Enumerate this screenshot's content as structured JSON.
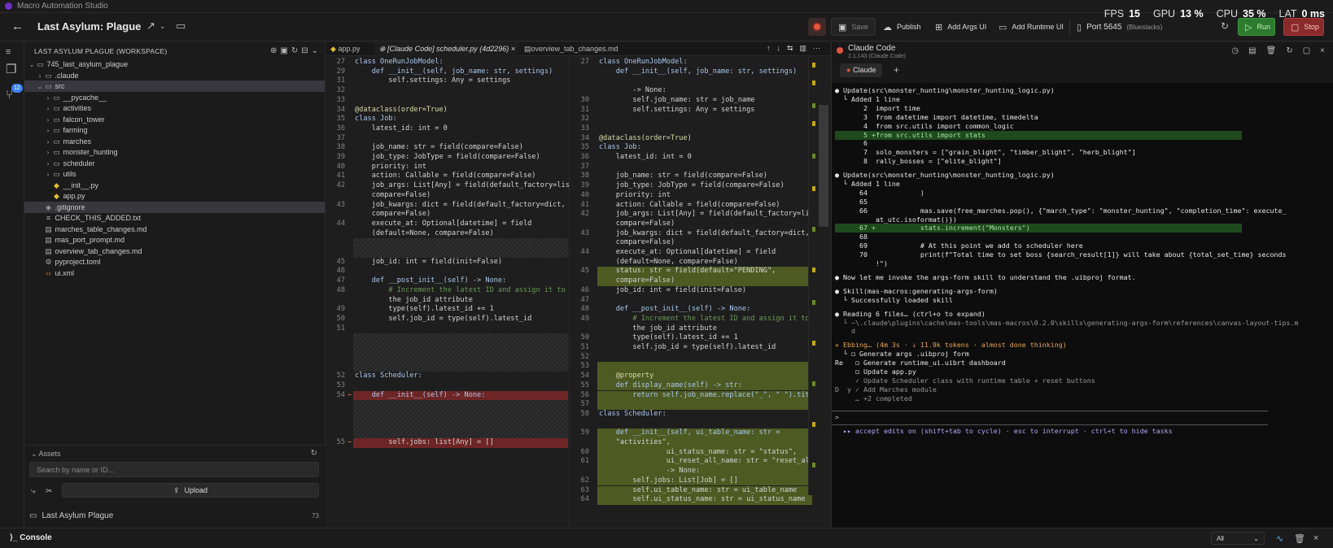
{
  "app": {
    "window_title": "Macro Automation Studio"
  },
  "toolbar": {
    "project_title": "Last Asylum: Plague",
    "save": "Save",
    "publish": "Publish",
    "add_args_ui": "Add Args UI",
    "add_runtime_ui": "Add Runtime UI",
    "port": "Port 5645",
    "port_note": "(Bluestacks)",
    "run": "Run",
    "stop": "Stop"
  },
  "stats": [
    {
      "label": "FPS",
      "value": "15"
    },
    {
      "label": "GPU",
      "value": "13 %"
    },
    {
      "label": "CPU",
      "value": "35 %"
    },
    {
      "label": "LAT",
      "value": "0 ms"
    }
  ],
  "sidebar": {
    "badge": "12"
  },
  "explorer": {
    "header": "LAST ASYLUM PLAGUE (WORKSPACE)",
    "items": [
      {
        "label": "745_last_asylum_plague",
        "indent": 0,
        "chev": "v",
        "icon": "folder-icon"
      },
      {
        "label": ".claude",
        "indent": 1,
        "chev": ">",
        "icon": "folder-icon"
      },
      {
        "label": "src",
        "indent": 1,
        "chev": "v",
        "icon": "folder-icon",
        "selected": true
      },
      {
        "label": "__pycache__",
        "indent": 2,
        "chev": ">",
        "icon": "folder-icon"
      },
      {
        "label": "activities",
        "indent": 2,
        "chev": ">",
        "icon": "folder-icon"
      },
      {
        "label": "falcon_tower",
        "indent": 2,
        "chev": ">",
        "icon": "folder-icon"
      },
      {
        "label": "farming",
        "indent": 2,
        "chev": ">",
        "icon": "folder-icon"
      },
      {
        "label": "marches",
        "indent": 2,
        "chev": ">",
        "icon": "folder-icon"
      },
      {
        "label": "monster_hunting",
        "indent": 2,
        "chev": ">",
        "icon": "folder-icon"
      },
      {
        "label": "scheduler",
        "indent": 2,
        "chev": ">",
        "icon": "folder-icon"
      },
      {
        "label": "utils",
        "indent": 2,
        "chev": ">",
        "icon": "folder-icon"
      },
      {
        "label": "__init__.py",
        "indent": 2,
        "chev": "",
        "icon": "python-file-icon"
      },
      {
        "label": "app.py",
        "indent": 2,
        "chev": "",
        "icon": "python-file-icon"
      },
      {
        "label": ".gitignore",
        "indent": 1,
        "chev": "",
        "icon": "gitignore-icon",
        "selected": true
      },
      {
        "label": "CHECK_THIS_ADDED.txt",
        "indent": 1,
        "chev": "",
        "icon": "text-file-icon"
      },
      {
        "label": "marches_table_changes.md",
        "indent": 1,
        "chev": "",
        "icon": "markdown-file-icon"
      },
      {
        "label": "mas_port_prompt.md",
        "indent": 1,
        "chev": "",
        "icon": "markdown-file-icon"
      },
      {
        "label": "overview_tab_changes.md",
        "indent": 1,
        "chev": "",
        "icon": "markdown-file-icon"
      },
      {
        "label": "pyproject.toml",
        "indent": 1,
        "chev": "",
        "icon": "toml-file-icon"
      },
      {
        "label": "ui.xml",
        "indent": 1,
        "chev": "",
        "icon": "xml-file-icon"
      }
    ]
  },
  "assets": {
    "header": "Assets",
    "search_placeholder": "Search by name or ID...",
    "upload": "Upload",
    "project": "Last Asylum Plague",
    "project_count": "73"
  },
  "editor": {
    "tabs": [
      {
        "label": "app.py"
      },
      {
        "label": "⊕ [Claude Code] scheduler.py (4d2296)",
        "active": true
      },
      {
        "label": "overview_tab_changes.md"
      }
    ],
    "left": [
      {
        "t": "text",
        "n": "27",
        "c": "class OneRunJobModel:"
      },
      {
        "t": "text",
        "n": "29",
        "c": "    def __init__(self, job_name: str, settings)"
      },
      {
        "t": "text",
        "n": "31",
        "c": "        self.settings: Any = settings"
      },
      {
        "t": "text",
        "n": "32",
        "c": ""
      },
      {
        "t": "text",
        "n": "33",
        "c": ""
      },
      {
        "t": "text",
        "n": "34",
        "c": "@dataclass(order=True)"
      },
      {
        "t": "text",
        "n": "35",
        "c": "class Job:"
      },
      {
        "t": "text",
        "n": "36",
        "c": "    latest_id: int = 0"
      },
      {
        "t": "text",
        "n": "37",
        "c": ""
      },
      {
        "t": "text",
        "n": "38",
        "c": "    job_name: str = field(compare=False)"
      },
      {
        "t": "text",
        "n": "39",
        "c": "    job_type: JobType = field(compare=False)"
      },
      {
        "t": "text",
        "n": "40",
        "c": "    priority: int"
      },
      {
        "t": "text",
        "n": "41",
        "c": "    action: Callable = field(compare=False)"
      },
      {
        "t": "text",
        "n": "42",
        "c": "    job_args: List[Any] = field(default_factory=list,"
      },
      {
        "t": "text",
        "n": "",
        "c": "    compare=False)"
      },
      {
        "t": "text",
        "n": "43",
        "c": "    job_kwargs: dict = field(default_factory=dict,"
      },
      {
        "t": "text",
        "n": "",
        "c": "    compare=False)"
      },
      {
        "t": "text",
        "n": "44",
        "c": "    execute_at: Optional[datetime] = field"
      },
      {
        "t": "text",
        "n": "",
        "c": "    (default=None, compare=False)"
      },
      {
        "t": "hatch",
        "h": 2
      },
      {
        "t": "text",
        "n": "45",
        "c": "    job_id: int = field(init=False)"
      },
      {
        "t": "text",
        "n": "46",
        "c": ""
      },
      {
        "t": "text",
        "n": "47",
        "c": "    def __post_init__(self) -> None:"
      },
      {
        "t": "text",
        "n": "48",
        "c": "        # Increment the latest ID and assign it to"
      },
      {
        "t": "text",
        "n": "",
        "c": "        the job_id attribute"
      },
      {
        "t": "text",
        "n": "49",
        "c": "        type(self).latest_id += 1"
      },
      {
        "t": "text",
        "n": "50",
        "c": "        self.job_id = type(self).latest_id"
      },
      {
        "t": "text",
        "n": "51",
        "c": ""
      },
      {
        "t": "hatch",
        "h": 4
      },
      {
        "t": "text",
        "n": "52",
        "c": "class Scheduler:"
      },
      {
        "t": "text",
        "n": "53",
        "c": ""
      },
      {
        "t": "del",
        "n": "54",
        "c": "    def __init__(self) -> None:"
      },
      {
        "t": "hatch",
        "h": 4
      },
      {
        "t": "del",
        "n": "55",
        "c": "        self.jobs: list[Any] = []"
      }
    ],
    "right": [
      {
        "t": "text",
        "n": "27",
        "c": "class OneRunJobModel:"
      },
      {
        "t": "text",
        "n": "",
        "c": "    def __init__(self, job_name: str, settings)"
      },
      {
        "t": "text",
        "n": "",
        "c": ""
      },
      {
        "t": "text",
        "n": "",
        "c": "        -> None:"
      },
      {
        "t": "text",
        "n": "30",
        "c": "        self.job_name: str = job_name"
      },
      {
        "t": "text",
        "n": "31",
        "c": "        self.settings: Any = settings"
      },
      {
        "t": "text",
        "n": "32",
        "c": ""
      },
      {
        "t": "text",
        "n": "33",
        "c": ""
      },
      {
        "t": "text",
        "n": "34",
        "c": "@dataclass(order=True)"
      },
      {
        "t": "text",
        "n": "35",
        "c": "class Job:"
      },
      {
        "t": "text",
        "n": "36",
        "c": "    latest_id: int = 0"
      },
      {
        "t": "text",
        "n": "37",
        "c": ""
      },
      {
        "t": "text",
        "n": "38",
        "c": "    job_name: str = field(compare=False)"
      },
      {
        "t": "text",
        "n": "39",
        "c": "    job_type: JobType = field(compare=False)"
      },
      {
        "t": "text",
        "n": "40",
        "c": "    priority: int"
      },
      {
        "t": "text",
        "n": "41",
        "c": "    action: Callable = field(compare=False)"
      },
      {
        "t": "text",
        "n": "42",
        "c": "    job_args: List[Any] = field(default_factory=list,"
      },
      {
        "t": "text",
        "n": "",
        "c": "    compare=False)"
      },
      {
        "t": "text",
        "n": "43",
        "c": "    job_kwargs: dict = field(default_factory=dict,"
      },
      {
        "t": "text",
        "n": "",
        "c": "    compare=False)"
      },
      {
        "t": "text",
        "n": "44",
        "c": "    execute_at: Optional[datetime] = field"
      },
      {
        "t": "text",
        "n": "",
        "c": "    (default=None, compare=False)"
      },
      {
        "t": "add",
        "n": "45",
        "c": "    status: str = field(default=\"PENDING\","
      },
      {
        "t": "add",
        "n": "",
        "c": "    compare=False)"
      },
      {
        "t": "text",
        "n": "46",
        "c": "    job_id: int = field(init=False)"
      },
      {
        "t": "text",
        "n": "47",
        "c": ""
      },
      {
        "t": "text",
        "n": "48",
        "c": "    def __post_init__(self) -> None:"
      },
      {
        "t": "text",
        "n": "49",
        "c": "        # Increment the latest ID and assign it to"
      },
      {
        "t": "text",
        "n": "",
        "c": "        the job_id attribute"
      },
      {
        "t": "text",
        "n": "50",
        "c": "        type(self).latest_id += 1"
      },
      {
        "t": "text",
        "n": "51",
        "c": "        self.job_id = type(self).latest_id"
      },
      {
        "t": "text",
        "n": "52",
        "c": ""
      },
      {
        "t": "add",
        "n": "53",
        "c": ""
      },
      {
        "t": "add",
        "n": "54",
        "c": "    @property"
      },
      {
        "t": "add",
        "n": "55",
        "c": "    def display_name(self) -> str:"
      },
      {
        "t": "add",
        "n": "56",
        "c": "        return self.job_name.replace(\"_\", \" \").title()"
      },
      {
        "t": "add",
        "n": "57",
        "c": ""
      },
      {
        "t": "text",
        "n": "58",
        "c": "class Scheduler:"
      },
      {
        "t": "text",
        "n": "",
        "c": ""
      },
      {
        "t": "add",
        "n": "59",
        "c": "    def __init__(self, ui_table_name: str ="
      },
      {
        "t": "add",
        "n": "",
        "c": "    \"activities\","
      },
      {
        "t": "add",
        "n": "60",
        "c": "                ui_status_name: str = \"status\","
      },
      {
        "t": "add",
        "n": "61",
        "c": "                ui_reset_all_name: str = \"reset_all\")"
      },
      {
        "t": "add",
        "n": "",
        "c": "                -> None:"
      },
      {
        "t": "add",
        "n": "62",
        "c": "        self.jobs: List[Job] = []"
      },
      {
        "t": "add",
        "n": "63",
        "c": "        self.ui_table_name: str = ui_table_name"
      },
      {
        "t": "add",
        "n": "64",
        "c": "        self.ui_status_name: str = ui_status_name"
      }
    ]
  },
  "claude": {
    "title": "Claude Code",
    "subtitle": "2.1.143 (Claude Code)",
    "tab": "Claude",
    "lines": [
      {
        "k": "bullet",
        "c": "Update(src\\monster_hunting\\monster_hunting_logic.py)"
      },
      {
        "k": "text",
        "c": "  └ Added 1 line"
      },
      {
        "k": "text",
        "c": "       2  import time"
      },
      {
        "k": "text",
        "c": "       3  from datetime import datetime, timedelta"
      },
      {
        "k": "text",
        "c": "       4  from src.utils import common_logic"
      },
      {
        "k": "added",
        "c": "       5 +from src.utils import stats"
      },
      {
        "k": "text",
        "c": "       6"
      },
      {
        "k": "text",
        "c": "       7  solo_monsters = [\"grain_blight\", \"timber_blight\", \"herb_blight\"]"
      },
      {
        "k": "text",
        "c": "       8  rally_bosses = [\"elite_blight\"]"
      },
      {
        "k": "gap",
        "c": ""
      },
      {
        "k": "bullet",
        "c": "Update(src\\monster_hunting\\monster_hunting_logic.py)"
      },
      {
        "k": "text",
        "c": "  └ Added 1 line"
      },
      {
        "k": "text",
        "c": "      64             )"
      },
      {
        "k": "text",
        "c": "      65"
      },
      {
        "k": "text",
        "c": "      66             mas.save(free_marches.pop(), {\"march_type\": \"monster_hunting\", \"completion_time\": execute_"
      },
      {
        "k": "text",
        "c": "          at_utc.isoformat()})"
      },
      {
        "k": "added",
        "c": "      67 +           stats.increment(\"Monsters\")"
      },
      {
        "k": "text",
        "c": "      68"
      },
      {
        "k": "text",
        "c": "      69             # At this point we add to scheduler here"
      },
      {
        "k": "text",
        "c": "      70             print(f\"Total time to set boss {search_result[1]} will take about {total_set_time} seconds"
      },
      {
        "k": "text",
        "c": "          !\")"
      },
      {
        "k": "gap",
        "c": ""
      },
      {
        "k": "bullet",
        "c": "Now let me invoke the args-form skill to understand the .uibproj format."
      },
      {
        "k": "gap",
        "c": ""
      },
      {
        "k": "bullet",
        "c": "Skill(mas-macros:generating-args-form)"
      },
      {
        "k": "text",
        "c": "  └ Successfully loaded skill"
      },
      {
        "k": "gap",
        "c": ""
      },
      {
        "k": "bullet",
        "c": "Reading 6 files… (ctrl+o to expand)"
      },
      {
        "k": "dim",
        "c": "  └ ~\\.claude\\plugins\\cache\\mas-tools\\mas-macros\\0.2.0\\skills\\generating-args-form\\references\\canvas-layout-tips.m"
      },
      {
        "k": "dim",
        "c": "    d"
      },
      {
        "k": "gap",
        "c": ""
      },
      {
        "k": "spin",
        "c": "✳ Ebbing… (4m 3s · ↓ 11.9k tokens · almost done thinking)"
      },
      {
        "k": "text",
        "c": "  └ ◻ Generate args .uibproj form"
      },
      {
        "k": "text",
        "c": "Re   ◻ Generate runtime_ui.uibrt dashboard"
      },
      {
        "k": "text",
        "c": "     ◻ Update app.py"
      },
      {
        "k": "dim",
        "c": "     ✓ Update Scheduler class with runtime table + reset buttons"
      },
      {
        "k": "dim",
        "c": "D  y ✓ Add Marches module"
      },
      {
        "k": "dim",
        "c": "     … +2 completed"
      },
      {
        "k": "gap",
        "c": ""
      },
      {
        "k": "gap",
        "c": ""
      },
      {
        "k": "prompt",
        "c": ">"
      },
      {
        "k": "gap",
        "c": ""
      },
      {
        "k": "mode",
        "c": "  ▸▸ accept edits on (shift+tab to cycle) · esc to interrupt · ctrl+t to hide tasks"
      }
    ]
  },
  "console": {
    "label": "Console",
    "filter": "All"
  },
  "colors": {
    "run": "#2d7a2f",
    "stop": "#8a2a2a",
    "added": "#4d5a22",
    "deleted": "#6e2525",
    "accent": "#3b82f6"
  }
}
